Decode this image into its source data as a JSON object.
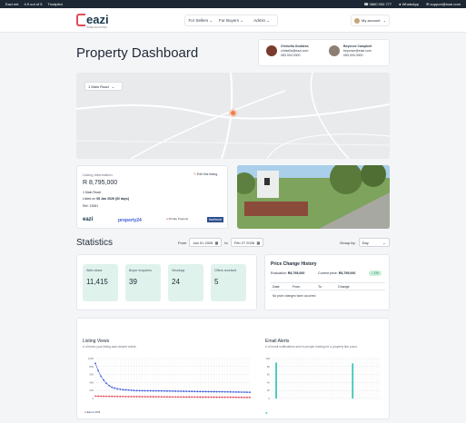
{
  "topbar": {
    "brand": "Eazi.net",
    "rating": "4.9 out of 5",
    "trustpilot": "Trustpilot",
    "phone": "0860 000 777",
    "whatsapp": "WhatsApp",
    "email": "support@eazi.com"
  },
  "nav": {
    "logo": "eazi",
    "logo_sub": "HOME SOLUTIONS",
    "for_sellers": "For Sellers",
    "for_buyers": "For Buyers",
    "admin": "Admin",
    "account": "My account"
  },
  "page_title": "Property Dashboard",
  "agents": [
    {
      "name": "Chrisella Goddess",
      "email": "chrisella@eazi.com",
      "phone": "083 000 0000"
    },
    {
      "name": "Beyonce Campbell",
      "email": "beyonce@eazi.com",
      "phone": "083 000 0000"
    }
  ],
  "map": {
    "address": "1 Main Road"
  },
  "listing": {
    "heading": "Listing Information",
    "edit": "Edit this listing",
    "price": "R 8,795,000",
    "address": "1 Main Road",
    "listed_label": "Listed on",
    "listed_value": "05 Jan 2026 (52 days)",
    "ref": "Ref: 13081",
    "portals": [
      "eazi",
      "property24",
      "Private Property",
      "facebook"
    ]
  },
  "stats": {
    "title": "Statistics",
    "from_label": "From",
    "from_date": "Jan 01 2026",
    "to_label": "to",
    "to_date": "Feb 27 2026",
    "group_label": "Group by:",
    "group_value": "Day"
  },
  "kpis": [
    {
      "label": "Web views",
      "value": "11,415"
    },
    {
      "label": "Buyer enquiries",
      "value": "39"
    },
    {
      "label": "Viewings",
      "value": "24"
    },
    {
      "label": "Offers received",
      "value": "5"
    }
  ],
  "price_change": {
    "title": "Price Change History",
    "eval_label": "Evaluation:",
    "eval_value": "R8,795,000",
    "current_label": "Current price:",
    "current_value": "R8,795,000",
    "badge": "1%",
    "cols": [
      "Date",
      "From",
      "To",
      "Change"
    ],
    "empty": "No price changes have occurred"
  },
  "charts": {
    "views_title": "Listing Views",
    "views_sub": "# of times your listing was viewed online.",
    "email_title": "Email Alerts",
    "email_sub": "# of email notifications sent to people looking for a property like yours.",
    "legend_a": "Eazi",
    "legend_b": "P24"
  },
  "chart_data": [
    {
      "type": "line",
      "title": "Listing Views",
      "ylim": [
        0,
        1000
      ],
      "series": [
        {
          "name": "Eazi",
          "values": [
            880,
            700,
            560,
            460,
            380,
            320,
            280,
            260,
            240,
            230,
            220,
            215,
            210,
            205,
            200,
            198,
            196,
            195,
            194,
            193,
            192,
            191,
            190,
            189,
            188,
            187,
            186,
            185,
            184,
            183,
            182,
            181,
            180,
            179,
            178,
            177,
            176,
            175,
            174,
            173,
            172,
            171,
            170,
            169,
            168,
            167,
            166,
            165,
            164,
            163,
            162,
            161,
            160,
            159,
            158,
            157,
            156
          ]
        },
        {
          "name": "P24",
          "values": [
            60,
            58,
            56,
            55,
            54,
            53,
            52,
            51,
            50,
            50,
            49,
            49,
            48,
            48,
            47,
            47,
            46,
            46,
            45,
            45,
            44,
            44,
            43,
            43,
            42,
            42,
            41,
            41,
            40,
            40,
            40,
            39,
            39,
            38,
            38,
            37,
            37,
            36,
            36,
            35,
            35,
            34,
            34,
            33,
            33,
            32,
            32,
            31,
            31,
            30,
            30,
            29,
            29,
            28,
            28,
            27,
            27
          ]
        }
      ]
    },
    {
      "type": "bar",
      "title": "Email Alerts",
      "ylim": [
        0,
        100
      ],
      "series": [
        {
          "values": [
            0,
            0,
            90,
            0,
            0,
            0,
            0,
            0,
            0,
            0,
            0,
            0,
            0,
            0,
            0,
            0,
            0,
            0,
            0,
            0,
            0,
            0,
            0,
            0,
            0,
            0,
            0,
            0,
            0,
            0,
            0,
            0,
            0,
            0,
            0,
            0,
            0,
            0,
            0,
            0,
            0,
            0,
            88,
            0,
            0,
            0,
            0,
            0,
            0,
            0,
            0,
            0,
            0,
            0,
            0,
            0,
            0
          ]
        }
      ]
    }
  ]
}
